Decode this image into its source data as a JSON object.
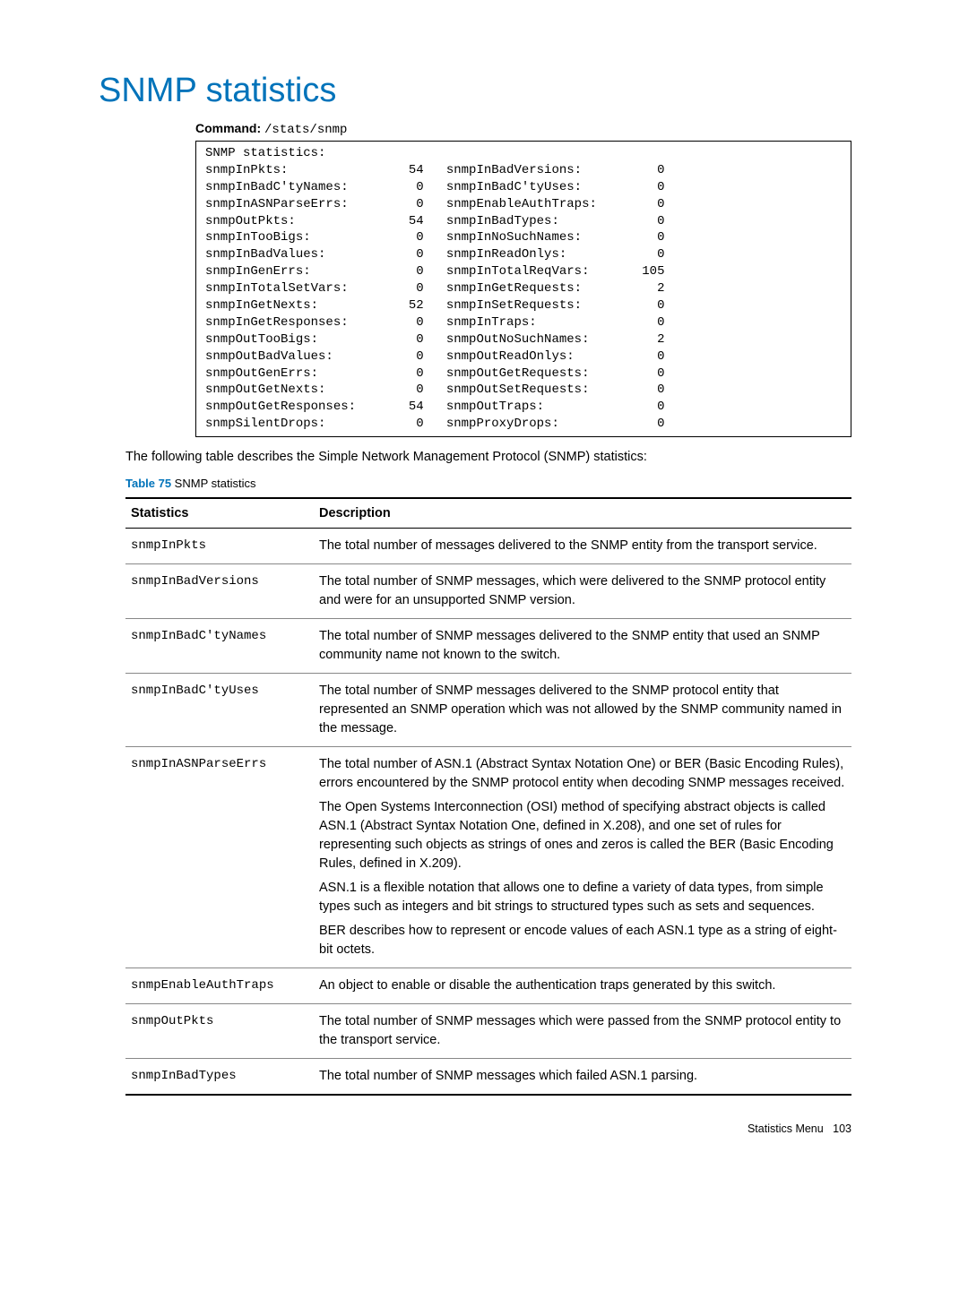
{
  "title": "SNMP statistics",
  "command_label": "Command:",
  "command_path": "/stats/snmp",
  "output_header": "SNMP statistics:",
  "output_rows": [
    {
      "l": "snmpInPkts:",
      "lv": "54",
      "r": "snmpInBadVersions:",
      "rv": "0"
    },
    {
      "l": "snmpInBadC'tyNames:",
      "lv": "0",
      "r": "snmpInBadC'tyUses:",
      "rv": "0"
    },
    {
      "l": "snmpInASNParseErrs:",
      "lv": "0",
      "r": "snmpEnableAuthTraps:",
      "rv": "0"
    },
    {
      "l": "snmpOutPkts:",
      "lv": "54",
      "r": "snmpInBadTypes:",
      "rv": "0"
    },
    {
      "l": "snmpInTooBigs:",
      "lv": "0",
      "r": "snmpInNoSuchNames:",
      "rv": "0"
    },
    {
      "l": "snmpInBadValues:",
      "lv": "0",
      "r": "snmpInReadOnlys:",
      "rv": "0"
    },
    {
      "l": "snmpInGenErrs:",
      "lv": "0",
      "r": "snmpInTotalReqVars:",
      "rv": "105"
    },
    {
      "l": "snmpInTotalSetVars:",
      "lv": "0",
      "r": "snmpInGetRequests:",
      "rv": "2"
    },
    {
      "l": "snmpInGetNexts:",
      "lv": "52",
      "r": "snmpInSetRequests:",
      "rv": "0"
    },
    {
      "l": "snmpInGetResponses:",
      "lv": "0",
      "r": "snmpInTraps:",
      "rv": "0"
    },
    {
      "l": "snmpOutTooBigs:",
      "lv": "0",
      "r": "snmpOutNoSuchNames:",
      "rv": "2"
    },
    {
      "l": "snmpOutBadValues:",
      "lv": "0",
      "r": "snmpOutReadOnlys:",
      "rv": "0"
    },
    {
      "l": "snmpOutGenErrs:",
      "lv": "0",
      "r": "snmpOutGetRequests:",
      "rv": "0"
    },
    {
      "l": "snmpOutGetNexts:",
      "lv": "0",
      "r": "snmpOutSetRequests:",
      "rv": "0"
    },
    {
      "l": "snmpOutGetResponses:",
      "lv": "54",
      "r": "snmpOutTraps:",
      "rv": "0"
    },
    {
      "l": "snmpSilentDrops:",
      "lv": "0",
      "r": "snmpProxyDrops:",
      "rv": "0"
    }
  ],
  "intro": "The following table describes the Simple Network Management Protocol (SNMP) statistics:",
  "table_caption_prefix": "Table 75",
  "table_caption_text": "  SNMP statistics",
  "col1": "Statistics",
  "col2": "Description",
  "table_rows": [
    {
      "stat": "snmpInPkts",
      "desc": [
        "The total number of messages delivered to the SNMP entity from the transport service."
      ]
    },
    {
      "stat": "snmpInBadVersions",
      "desc": [
        "The total number of SNMP messages, which were delivered to the SNMP protocol entity and were for an unsupported SNMP version."
      ]
    },
    {
      "stat": "snmpInBadC'tyNames",
      "desc": [
        "The total number of SNMP messages delivered to the SNMP entity that used an SNMP community name not known to the switch."
      ]
    },
    {
      "stat": "snmpInBadC'tyUses",
      "desc": [
        "The total number of SNMP messages delivered to the SNMP protocol entity that represented an SNMP operation which was not allowed by the SNMP community named in the message."
      ]
    },
    {
      "stat": "snmpInASNParseErrs",
      "desc": [
        "The total number of ASN.1 (Abstract Syntax Notation One) or BER (Basic Encoding Rules), errors encountered by the SNMP protocol entity when decoding SNMP messages received.",
        "The Open Systems Interconnection (OSI) method of specifying abstract objects is called ASN.1 (Abstract Syntax Notation One, defined in X.208), and one set of rules for representing such objects as strings of ones and zeros is called the BER (Basic Encoding Rules, defined in X.209).",
        "ASN.1 is a flexible notation that allows one to define a variety of data types, from simple types such as integers and bit strings to structured types such as sets and sequences.",
        "BER describes how to represent or encode values of each ASN.1 type as a string of eight-bit octets."
      ]
    },
    {
      "stat": "snmpEnableAuthTraps",
      "desc": [
        "An object to enable or disable the authentication traps generated by this switch."
      ]
    },
    {
      "stat": "snmpOutPkts",
      "desc": [
        "The total number of SNMP messages which were passed from the SNMP protocol entity to the transport service."
      ]
    },
    {
      "stat": "snmpInBadTypes",
      "desc": [
        "The total number of SNMP messages which failed ASN.1 parsing."
      ]
    }
  ],
  "footer_label": "Statistics Menu",
  "footer_page": "103"
}
